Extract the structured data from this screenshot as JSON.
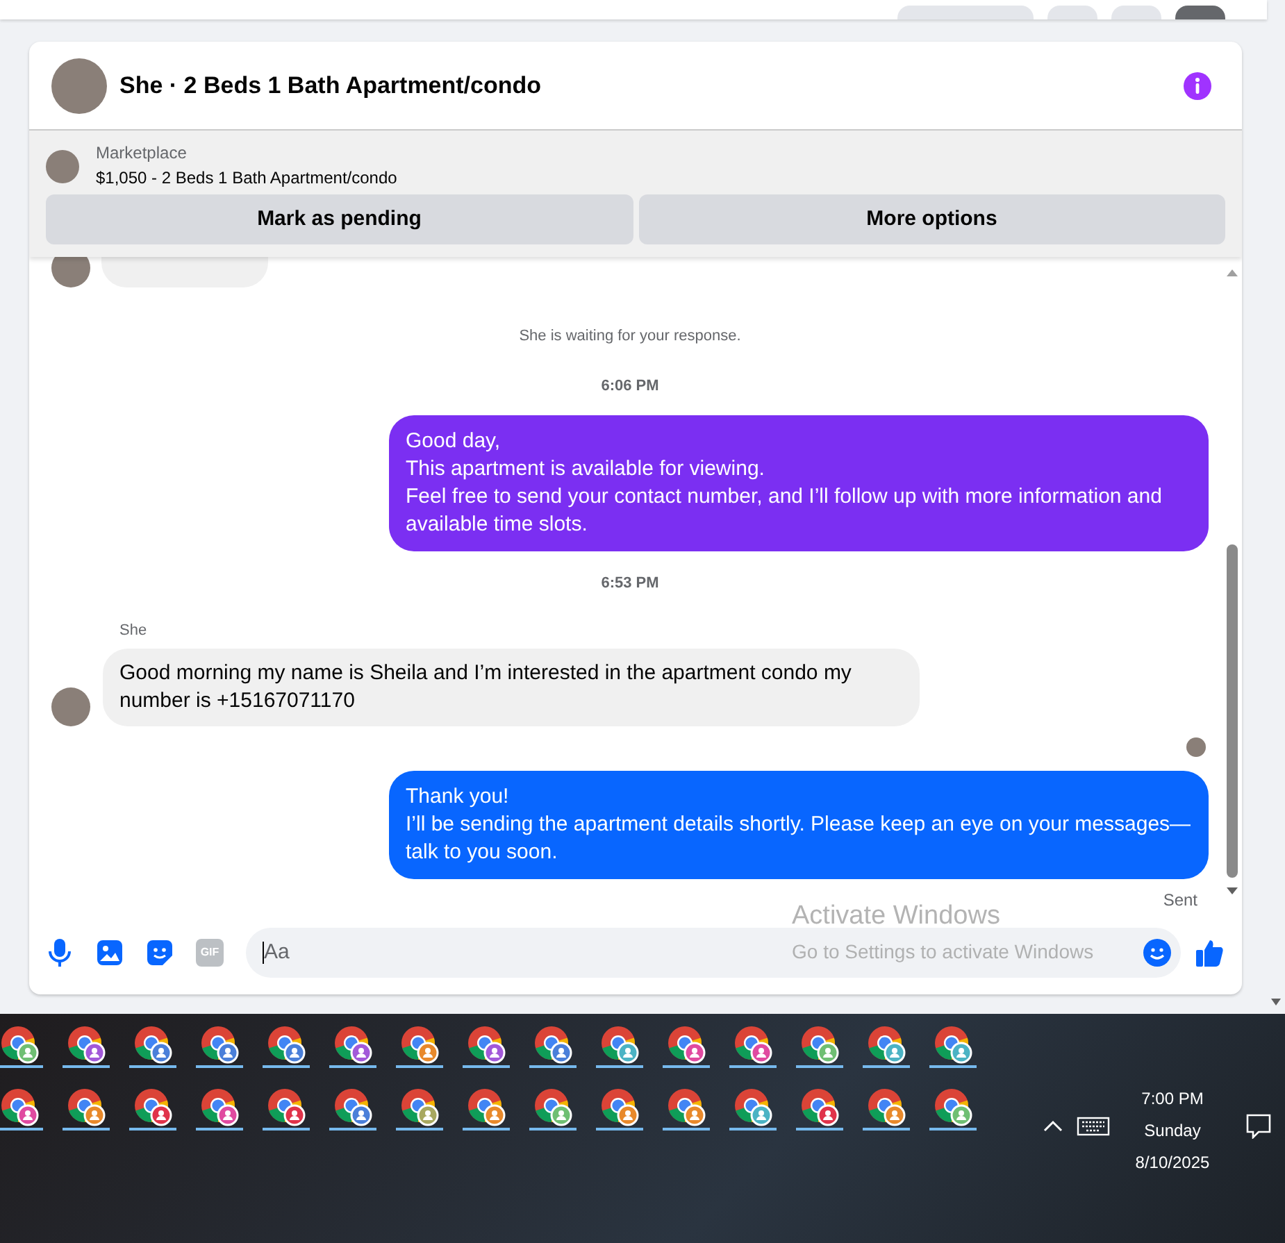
{
  "conversation": {
    "title": "She · 2 Beds 1 Bath Apartment/condo"
  },
  "listing": {
    "source": "Marketplace",
    "summary": "$1,050 - 2 Beds 1 Bath Apartment/condo",
    "actions": [
      "Mark as pending",
      "More options"
    ]
  },
  "messages": [
    {
      "kind": "partial"
    },
    {
      "kind": "status",
      "text": "She is waiting for your response."
    },
    {
      "kind": "time",
      "text": "6:06 PM"
    },
    {
      "kind": "outgoing",
      "color": "#7b2ff2",
      "text": "Good day,\nThis apartment is available for viewing.\nFeel free to send your contact number, and I’ll follow up with more information and available time slots."
    },
    {
      "kind": "time",
      "text": "6:53 PM"
    },
    {
      "kind": "sender",
      "text": "She"
    },
    {
      "kind": "incoming",
      "text": "Good morning my name is Sheila and I’m interested in the apartment condo my number is +15167071170"
    },
    {
      "kind": "seen"
    },
    {
      "kind": "outgoing",
      "color": "#0866ff",
      "text": "Thank you!\nI’ll be sending the apartment details shortly. Please keep an eye on your messages—talk to you soon."
    },
    {
      "kind": "status_right",
      "text": "Sent"
    }
  ],
  "composer": {
    "gif": "GIF",
    "placeholder": "Aa"
  },
  "activation": {
    "title": "Activate Windows",
    "hint": "Go to Settings to activate Windows"
  },
  "taskbar": {
    "apps": [
      {
        "color": "#6fbf73"
      },
      {
        "color": "#a259d9"
      },
      {
        "color": "#4a7fd9"
      },
      {
        "color": "#4a7fd9"
      },
      {
        "color": "#4a7fd9"
      },
      {
        "color": "#a259d9"
      },
      {
        "color": "#e8892b"
      },
      {
        "color": "#a259d9"
      },
      {
        "color": "#4a7fd9"
      },
      {
        "color": "#4bb3c4"
      },
      {
        "color": "#e04aa0"
      },
      {
        "color": "#e04aa0"
      },
      {
        "color": "#6fbf73"
      },
      {
        "color": "#4bb3c4"
      },
      {
        "color": "#4bb3c4"
      },
      {
        "color": "#e04aa0"
      },
      {
        "color": "#e8892b"
      },
      {
        "color": "#e0334a"
      },
      {
        "color": "#e04aa0"
      },
      {
        "color": "#e0334a"
      },
      {
        "color": "#4a7fd9"
      },
      {
        "color": "#a8a860"
      },
      {
        "color": "#e8892b"
      },
      {
        "color": "#6fbf73"
      },
      {
        "color": "#e8892b"
      },
      {
        "color": "#e8892b"
      },
      {
        "color": "#4bb3c4"
      },
      {
        "color": "#e0334a"
      },
      {
        "color": "#e8892b"
      },
      {
        "color": "#6fbf73"
      }
    ],
    "time": "7:00 PM",
    "day": "Sunday",
    "date": "8/10/2025"
  }
}
